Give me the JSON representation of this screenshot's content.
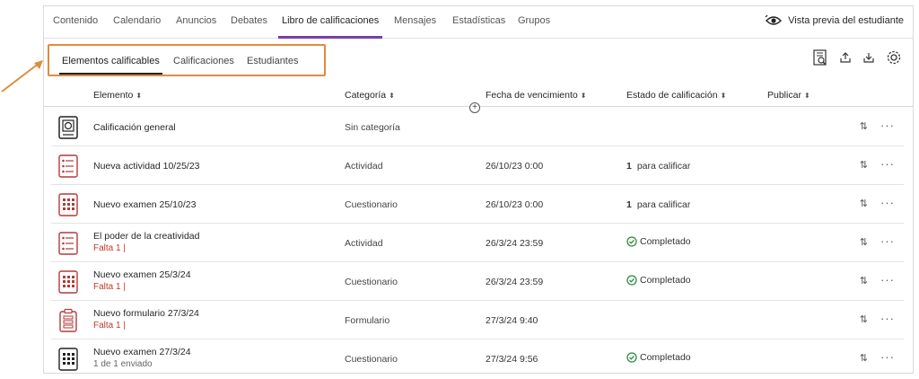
{
  "nav": {
    "tabs": [
      {
        "label": "Contenido"
      },
      {
        "label": "Calendario"
      },
      {
        "label": "Anuncios"
      },
      {
        "label": "Debates"
      },
      {
        "label": "Libro de calificaciones"
      },
      {
        "label": "Mensajes"
      },
      {
        "label": "Estadísticas"
      },
      {
        "label": "Grupos"
      }
    ],
    "active_tab": "Libro de calificaciones",
    "preview_label": "Vista previa del estudiante"
  },
  "subtabs": {
    "items": [
      {
        "label": "Elementos calificables"
      },
      {
        "label": "Calificaciones"
      },
      {
        "label": "Estudiantes"
      }
    ],
    "active": "Elementos calificables"
  },
  "toolbar": {
    "icons": [
      "search-report-icon",
      "upload-icon",
      "download-icon",
      "settings-gear-icon"
    ]
  },
  "table": {
    "headers": {
      "element": "Elemento",
      "category": "Categoría",
      "due": "Fecha de vencimiento",
      "status": "Estado de calificación",
      "publish": "Publicar"
    },
    "rows": [
      {
        "icon": "overall-grade-icon",
        "name": "Calificación general",
        "sub": "",
        "category": "Sin categoría",
        "due": "",
        "status_count": "",
        "status": ""
      },
      {
        "icon": "activity-icon",
        "name": "Nueva actividad 10/25/23",
        "sub": "",
        "category": "Actividad",
        "due": "26/10/23 0:00",
        "status_count": "1",
        "status": "para calificar"
      },
      {
        "icon": "exam-icon",
        "name": "Nuevo examen 25/10/23",
        "sub": "",
        "category": "Cuestionario",
        "due": "26/10/23 0:00",
        "status_count": "1",
        "status": "para calificar"
      },
      {
        "icon": "activity-icon",
        "name": "El poder de la creatividad",
        "sub": "Falta 1  |",
        "category": "Actividad",
        "due": "26/3/24 23:59",
        "status_count": "",
        "status": "Completado"
      },
      {
        "icon": "exam-icon",
        "name": "Nuevo examen 25/3/24",
        "sub": "Falta 1  |",
        "category": "Cuestionario",
        "due": "26/3/24 23:59",
        "status_count": "",
        "status": "Completado"
      },
      {
        "icon": "form-icon",
        "name": "Nuevo formulario 27/3/24",
        "sub": "Falta 1  |",
        "category": "Formulario",
        "due": "27/3/24 9:40",
        "status_count": "",
        "status": ""
      },
      {
        "icon": "exam-icon",
        "name": "Nuevo examen 27/3/24",
        "sub": "1 de 1 enviado",
        "category": "Cuestionario",
        "due": "27/3/24 9:56",
        "status_count": "",
        "status": "Completado"
      }
    ]
  },
  "colors": {
    "accent_purple": "#7b3fa6",
    "highlight_orange": "#e08b3e",
    "icon_red": "#b23a3a",
    "success_green": "#2e8b3a"
  }
}
